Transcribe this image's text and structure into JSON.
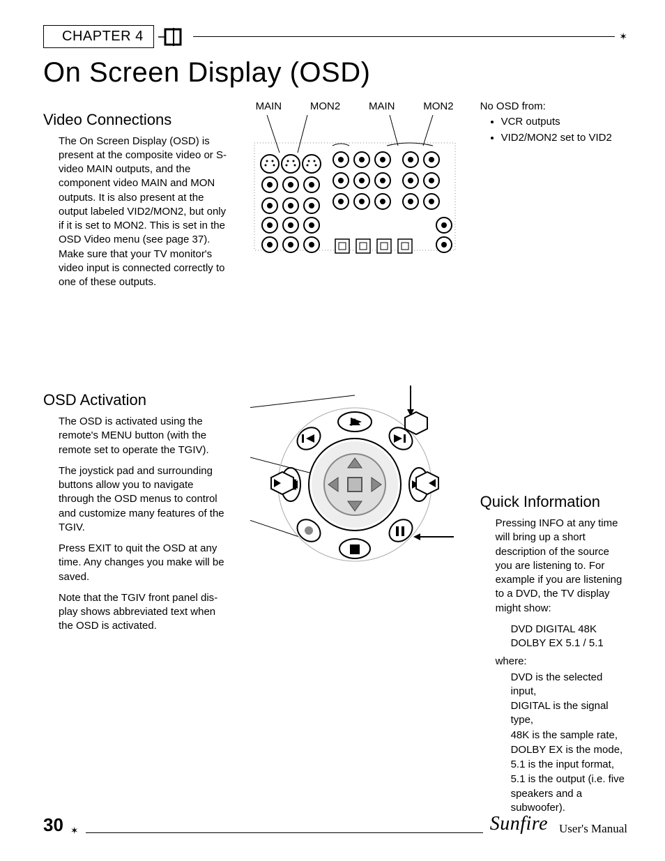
{
  "header": {
    "chapter": "CHAPTER 4"
  },
  "title": "On Screen Display (OSD)",
  "sections": {
    "video_connections": {
      "heading": "Video Connections",
      "body": "The On Screen Display (OSD) is present at the composite video or S-video MAIN outputs, and the component video MAIN and MON outputs. It is also present at the output labeled VID2/MON2, but only if it is set to MON2. This is set in the OSD Video menu (see page 37). Make sure that your TV monitor's video input is connected correctly to one of these outputs."
    },
    "diagram_labels": {
      "l1": "MAIN",
      "l2": "MON2",
      "l3": "MAIN",
      "l4": "MON2"
    },
    "no_osd": {
      "heading": "No OSD from:",
      "items": [
        "VCR outputs",
        "VID2/MON2 set to VID2"
      ]
    },
    "osd_activation": {
      "heading": "OSD Activation",
      "p1": "The OSD is activated using the remote's MENU button (with the remote set to operate the TGIV).",
      "p2": "The joystick pad and surround­ing buttons allow you to navigate through the OSD menus to control and customize many features of the TGIV.",
      "p3": "Press EXIT to quit the OSD at any time. Any changes you make will be saved.",
      "p4": "Note that the TGIV front panel dis­play shows abbreviated text when the OSD is activated."
    },
    "quick_info": {
      "heading": "Quick Information",
      "body": "Pressing INFO at any time will bring up a short description of the source you are listening to. For example if you are listening to a DVD, the TV display might show:",
      "example_line1": "DVD DIGITAL 48K",
      "example_line2": "DOLBY EX 5.1 / 5.1",
      "where": "where:",
      "lines": [
        "DVD is the selected input,",
        "DIGITAL is the signal type,",
        "48K is the sample rate,",
        "DOLBY EX is the mode,",
        "5.1 is the input format,",
        "5.1 is the output (i.e. five speakers and a subwoofer)."
      ]
    }
  },
  "footer": {
    "page": "30",
    "brand": "Sunfire",
    "manual": "User's Manual"
  }
}
